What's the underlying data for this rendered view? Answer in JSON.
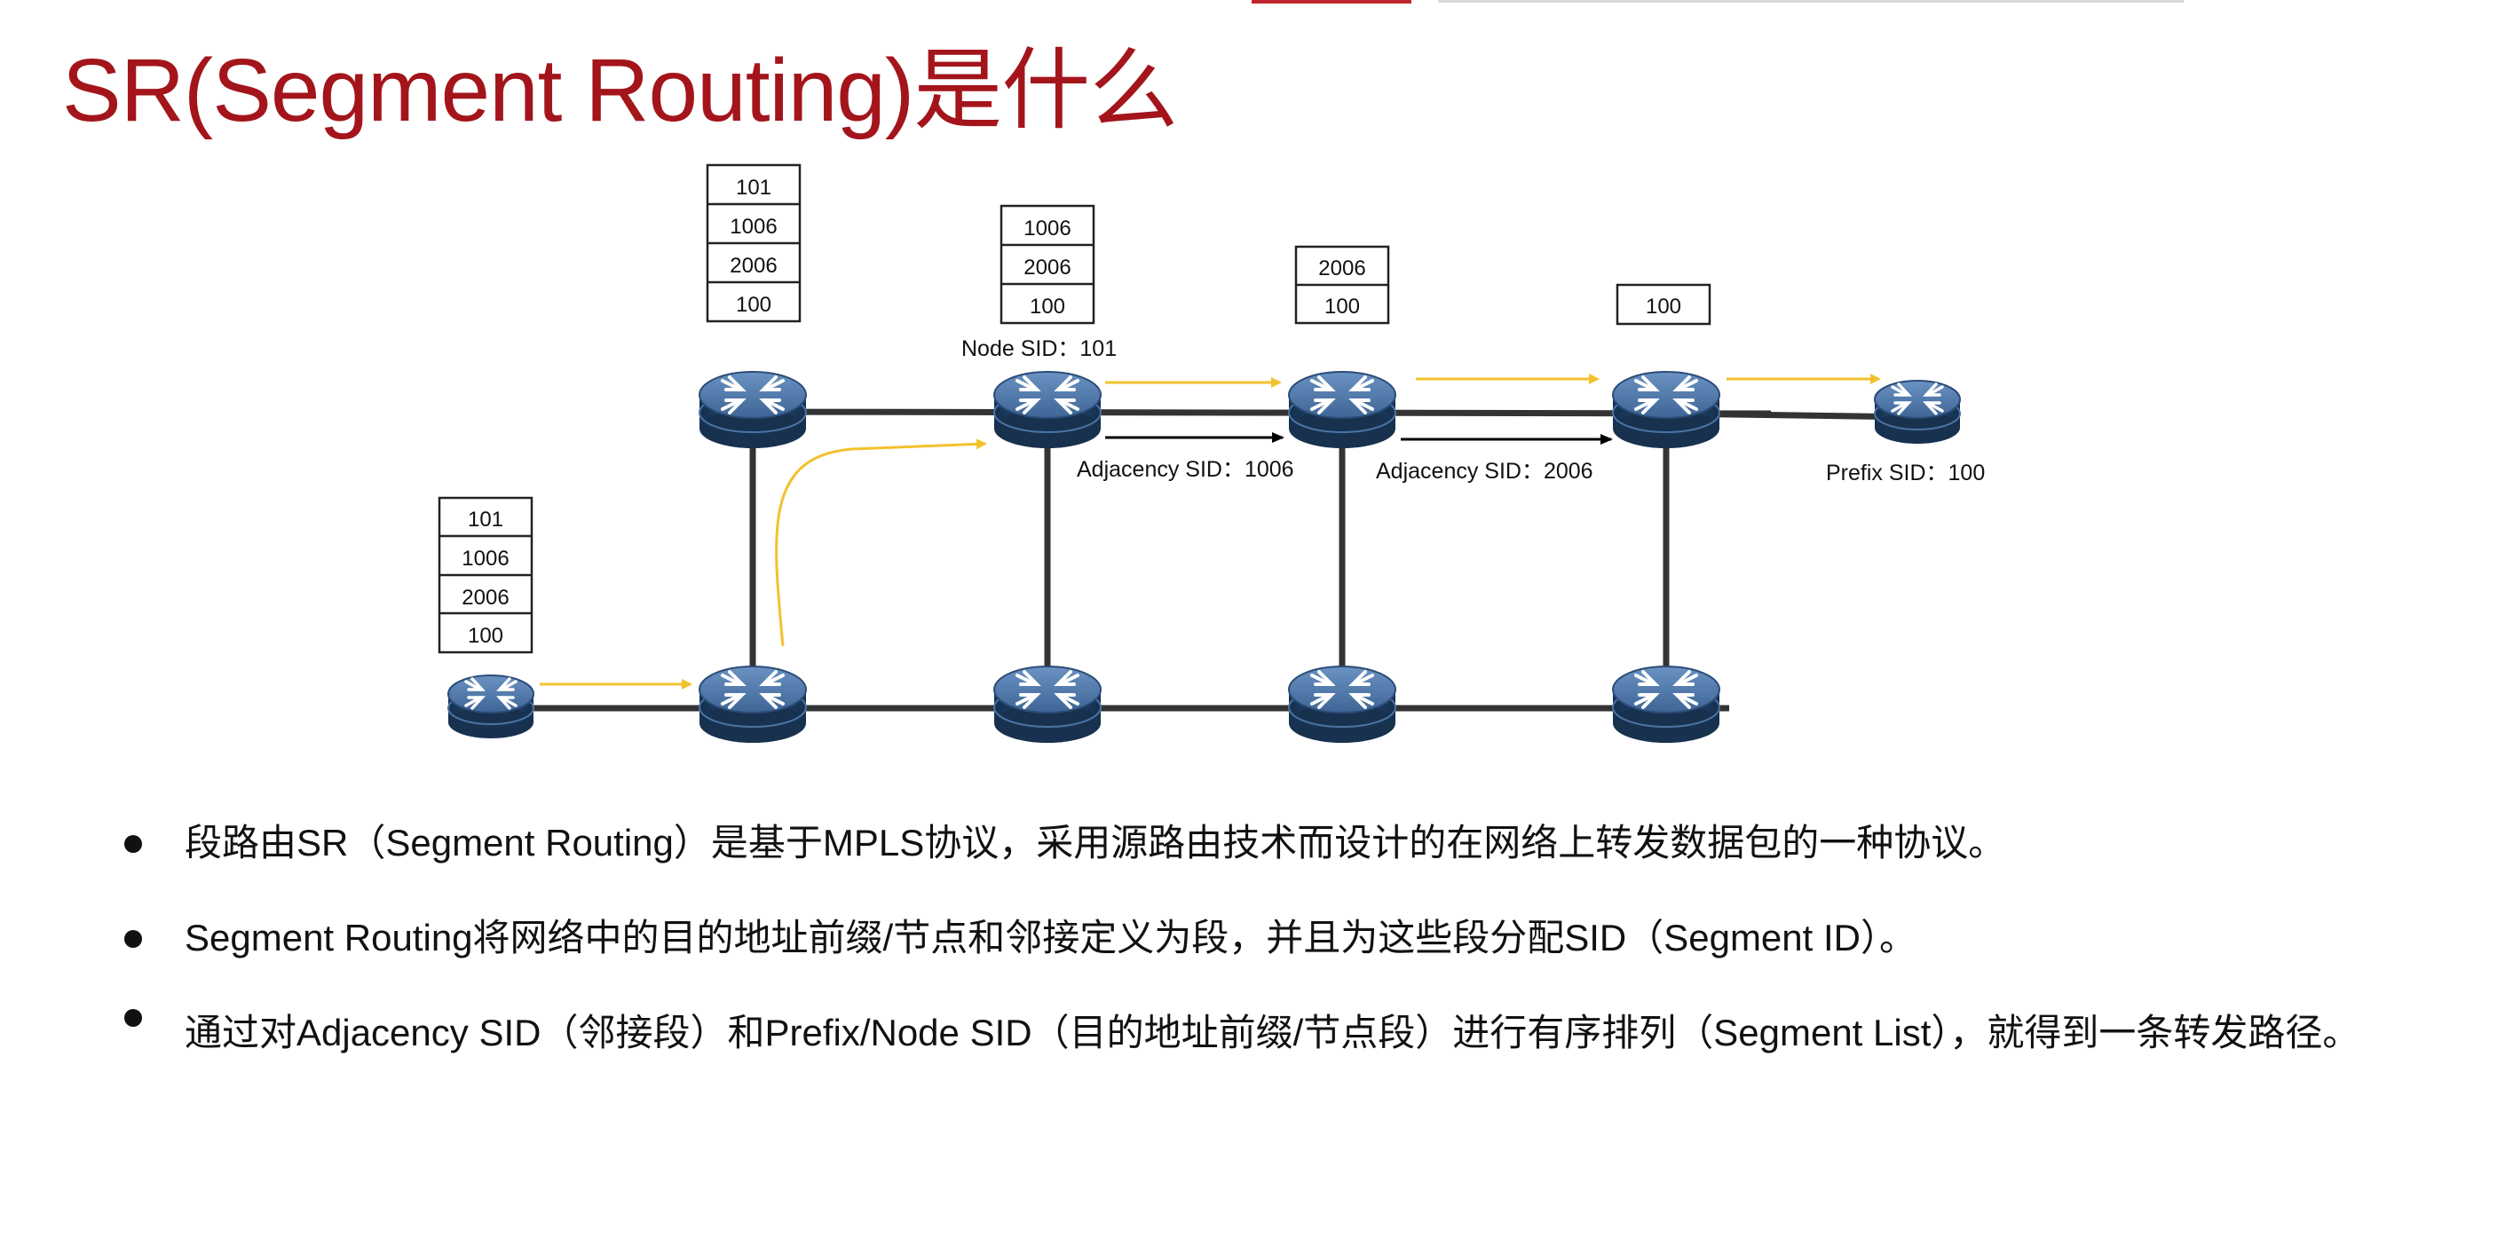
{
  "title": "SR(Segment Routing)是什么",
  "diagram": {
    "stacks": {
      "a": [
        "101",
        "1006",
        "2006",
        "100"
      ],
      "b": [
        "101",
        "1006",
        "2006",
        "100"
      ],
      "c": [
        "1006",
        "2006",
        "100"
      ],
      "d": [
        "2006",
        "100"
      ],
      "e": [
        "100"
      ]
    },
    "labels": {
      "node_sid": "Node SID：101",
      "adj_1006": "Adjacency SID：1006",
      "adj_2006": "Adjacency SID：2006",
      "prefix_sid": "Prefix SID：100"
    },
    "colors": {
      "router_body": "#1f3d63",
      "router_top": "#4e78a8",
      "link": "#333333",
      "forward_arrow": "#f2c12e",
      "adjacency_arrow": "#000000"
    }
  },
  "bullets": [
    "段路由SR（Segment Routing）是基于MPLS协议，采用源路由技术而设计的在网络上转发数据包的一种协议。",
    "Segment Routing将网络中的目的地址前缀/节点和邻接定义为段，并且为这些段分配SID（Segment ID）。",
    "通过对Adjacency SID（邻接段）和Prefix/Node SID（目的地址前缀/节点段）进行有序排列（Segment List），就得到一条转发路径。"
  ]
}
